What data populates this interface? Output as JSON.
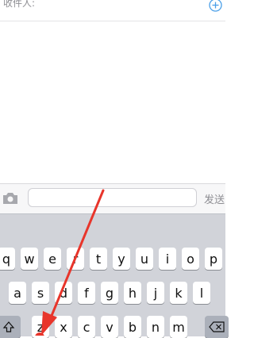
{
  "recipient_bar": {
    "label": "收件人:"
  },
  "input_bar": {
    "send_label": "发送",
    "message_value": ""
  },
  "keyboard": {
    "row1": [
      "q",
      "w",
      "e",
      "r",
      "t",
      "y",
      "u",
      "i",
      "o",
      "p"
    ],
    "row2": [
      "a",
      "s",
      "d",
      "f",
      "g",
      "h",
      "j",
      "k",
      "l"
    ],
    "row3": [
      "z",
      "x",
      "c",
      "v",
      "b",
      "n",
      "m"
    ]
  },
  "colors": {
    "accent": "#4a9fe8",
    "arrow": "#e8352b",
    "keyboard_bg": "#d1d3d9"
  }
}
